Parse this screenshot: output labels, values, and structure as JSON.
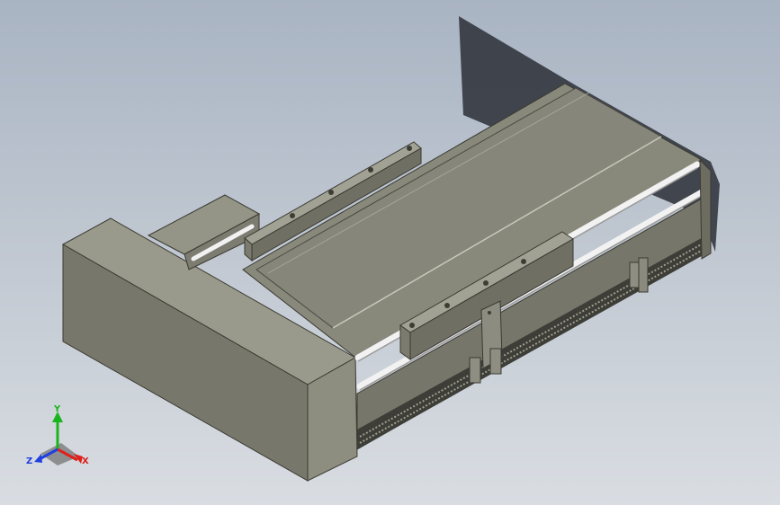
{
  "viewport": {
    "background_top": "#a9b4c3",
    "background_bottom": "#d9dde2"
  },
  "triad": {
    "x_label": "X",
    "y_label": "Y",
    "z_label": "Z",
    "x_color": "#e0201a",
    "y_color": "#19b51c",
    "z_color": "#1f3fe0"
  },
  "model": {
    "body_color": "#7f7f72",
    "rail_color": "#e8e8e8"
  }
}
